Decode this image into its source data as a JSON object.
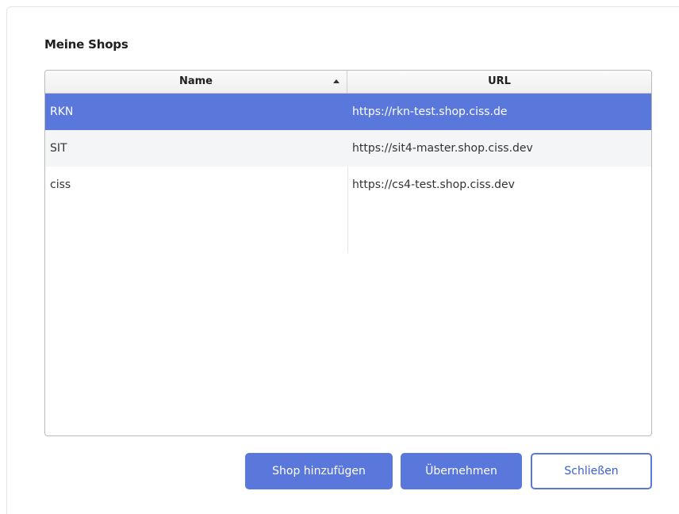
{
  "dialog": {
    "title": "Meine Shops"
  },
  "table": {
    "columns": [
      {
        "label": "Name",
        "sort": "ascending"
      },
      {
        "label": "URL"
      }
    ],
    "rows": [
      {
        "name": "RKN",
        "url": "https://rkn-test.shop.ciss.de",
        "selected": true
      },
      {
        "name": "SIT",
        "url": "https://sit4-master.shop.ciss.dev",
        "selected": false
      },
      {
        "name": "ciss",
        "url": "https://cs4-test.shop.ciss.dev",
        "selected": false
      }
    ]
  },
  "buttons": {
    "add_label": "Shop hinzufügen",
    "apply_label": "Übernehmen",
    "close_label": "Schließen"
  },
  "colors": {
    "accent": "#5a78dc",
    "selected_row": "#5a78dc",
    "alt_row": "#f4f5f7"
  }
}
